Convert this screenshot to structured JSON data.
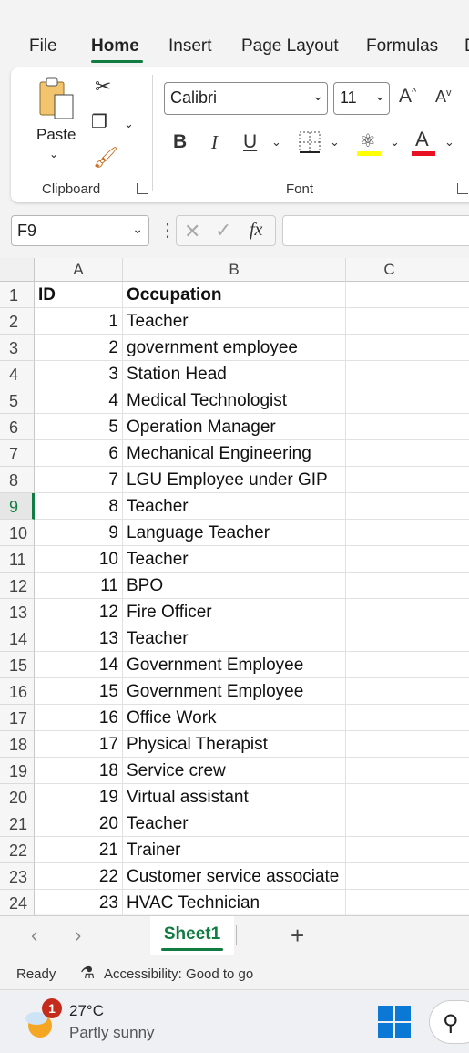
{
  "ribbon_tabs": [
    "File",
    "Home",
    "Insert",
    "Page Layout",
    "Formulas",
    "D"
  ],
  "active_tab": "Home",
  "clipboard": {
    "paste_label": "Paste",
    "group_label": "Clipboard"
  },
  "font": {
    "name": "Calibri",
    "size": "11",
    "group_label": "Font",
    "bold": "B",
    "italic": "I",
    "underline": "U",
    "grow": "A",
    "shrink": "A",
    "font_color_letter": "A",
    "highlight_color": "#ffff00",
    "font_color": "#e81123"
  },
  "formula_bar": {
    "name_box": "F9",
    "fx": "fx",
    "value": ""
  },
  "columns": [
    "A",
    "B",
    "C"
  ],
  "selected_row": 9,
  "rows": [
    {
      "n": "1",
      "a": "ID",
      "b": "Occupation",
      "header": true
    },
    {
      "n": "2",
      "a": "1",
      "b": "Teacher"
    },
    {
      "n": "3",
      "a": "2",
      "b": "government employee"
    },
    {
      "n": "4",
      "a": "3",
      "b": "Station Head"
    },
    {
      "n": "5",
      "a": "4",
      "b": "Medical Technologist"
    },
    {
      "n": "6",
      "a": "5",
      "b": "Operation Manager"
    },
    {
      "n": "7",
      "a": "6",
      "b": "Mechanical Engineering"
    },
    {
      "n": "8",
      "a": "7",
      "b": "LGU Employee under GIP"
    },
    {
      "n": "9",
      "a": "8",
      "b": "Teacher"
    },
    {
      "n": "10",
      "a": "9",
      "b": "Language Teacher"
    },
    {
      "n": "11",
      "a": "10",
      "b": "Teacher"
    },
    {
      "n": "12",
      "a": "11",
      "b": "BPO"
    },
    {
      "n": "13",
      "a": "12",
      "b": "Fire Officer"
    },
    {
      "n": "14",
      "a": "13",
      "b": "Teacher"
    },
    {
      "n": "15",
      "a": "14",
      "b": "Government Employee"
    },
    {
      "n": "16",
      "a": "15",
      "b": "Government Employee"
    },
    {
      "n": "17",
      "a": "16",
      "b": "Office Work"
    },
    {
      "n": "18",
      "a": "17",
      "b": "Physical Therapist"
    },
    {
      "n": "19",
      "a": "18",
      "b": "Service crew"
    },
    {
      "n": "20",
      "a": "19",
      "b": "Virtual assistant"
    },
    {
      "n": "21",
      "a": "20",
      "b": "Teacher"
    },
    {
      "n": "22",
      "a": "21",
      "b": "Trainer"
    },
    {
      "n": "23",
      "a": "22",
      "b": "Customer service associate"
    },
    {
      "n": "24",
      "a": "23",
      "b": "HVAC Technician"
    }
  ],
  "sheets": [
    "Sheet1"
  ],
  "status": {
    "ready": "Ready",
    "accessibility": "Accessibility: Good to go"
  },
  "taskbar": {
    "temperature": "27°C",
    "condition": "Partly sunny",
    "badge": "1"
  },
  "accent_color": "#107c41"
}
